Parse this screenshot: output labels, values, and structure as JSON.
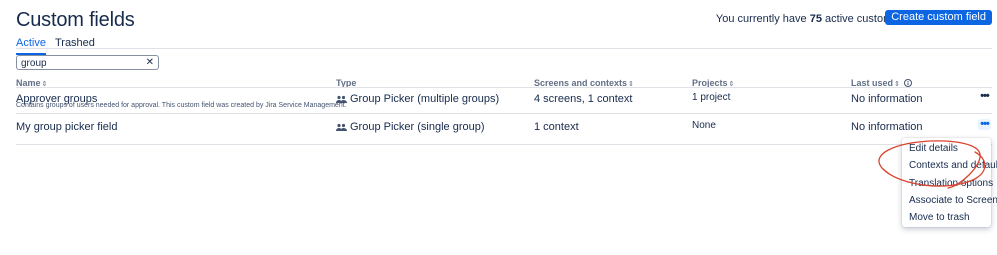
{
  "page": {
    "title": "Custom fields"
  },
  "summary": {
    "prefix": "You currently have",
    "count": "75",
    "suffix": "active custom fields"
  },
  "create_button": {
    "label": "Create custom field"
  },
  "tabs": [
    {
      "label": "Active",
      "active": true
    },
    {
      "label": "Trashed",
      "active": false
    }
  ],
  "search": {
    "value": "group"
  },
  "columns": {
    "name": "Name",
    "type": "Type",
    "screens": "Screens and contexts",
    "projects": "Projects",
    "last_used": "Last used"
  },
  "rows": [
    {
      "name": "Approver groups",
      "description": "Contains groups of users needed for approval. This custom field was created by Jira Service Management.",
      "type": "Group Picker (multiple groups)",
      "screens": "4 screens, 1 context",
      "projects": "1 project",
      "last_used": "No information"
    },
    {
      "name": "My group picker field",
      "description": "",
      "type": "Group Picker (single group)",
      "screens": "1 context",
      "projects": "None",
      "last_used": "No information"
    }
  ],
  "menu": {
    "items": [
      "Edit details",
      "Contexts and default value",
      "Translation options",
      "Associate to Screens",
      "Move to trash"
    ]
  },
  "colors": {
    "accent": "#0c66e4",
    "annotation": "#d9432f"
  },
  "icons": {
    "sort": "sort-arrows-icon",
    "info": "info-icon",
    "type": "people-group-icon",
    "more": "more-horizontal-icon",
    "clear": "close-icon"
  }
}
